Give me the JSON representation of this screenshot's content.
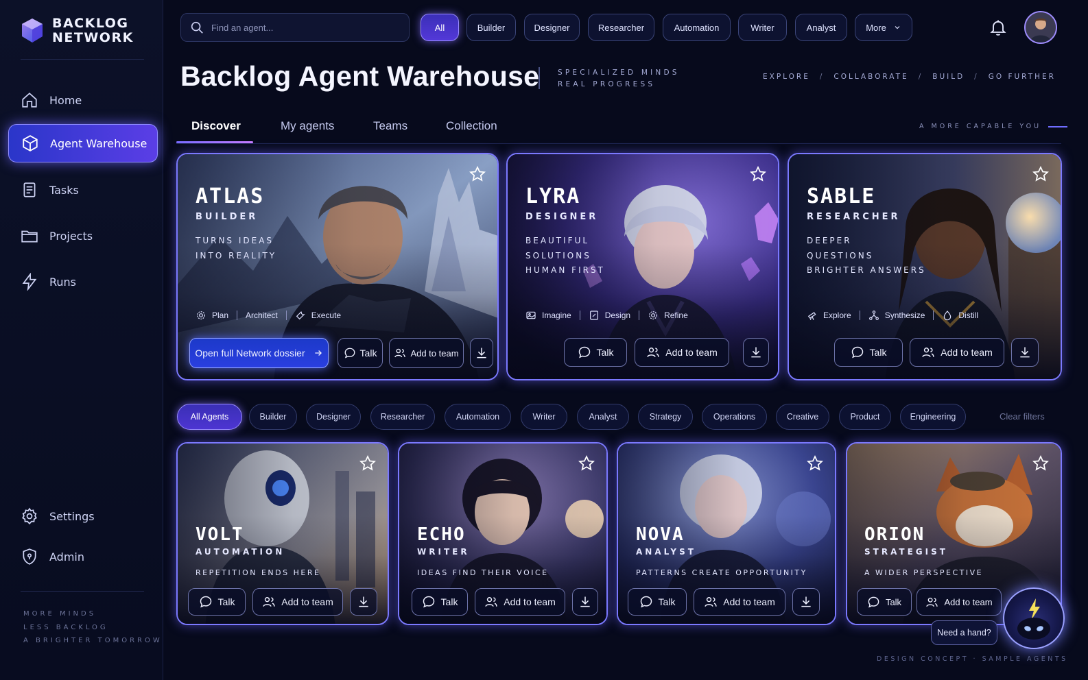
{
  "brand": {
    "line1": "BACKLOG",
    "line2": "NETWORK"
  },
  "sidebar": {
    "items": [
      {
        "label": "Home"
      },
      {
        "label": "Agent Warehouse"
      },
      {
        "label": "Tasks"
      },
      {
        "label": "Projects"
      },
      {
        "label": "Runs"
      }
    ],
    "bottom": [
      {
        "label": "Settings"
      },
      {
        "label": "Admin"
      }
    ],
    "tagline": [
      "MORE MINDS",
      "LESS BACKLOG",
      "A BRIGHTER TOMORROW"
    ]
  },
  "search": {
    "placeholder": "Find an agent..."
  },
  "top_filters": [
    "All",
    "Builder",
    "Designer",
    "Researcher",
    "Automation",
    "Writer",
    "Analyst",
    "More"
  ],
  "header": {
    "title": "Backlog Agent Warehouse",
    "sub1": "SPECIALIZED MINDS",
    "sub2": "REAL PROGRESS",
    "crumbs": [
      "EXPLORE",
      "COLLABORATE",
      "BUILD",
      "GO FURTHER"
    ]
  },
  "tabs": [
    "Discover",
    "My agents",
    "Teams",
    "Collection"
  ],
  "tab_tagline": "A MORE CAPABLE YOU",
  "featured": [
    {
      "name": "ATLAS",
      "role": "BUILDER",
      "tagline": [
        "TURNS IDEAS",
        "INTO REALITY"
      ],
      "skills": [
        "Plan",
        "Architect",
        "Execute"
      ],
      "primary": "Open full Network dossier"
    },
    {
      "name": "LYRA",
      "role": "DESIGNER",
      "tagline": [
        "BEAUTIFUL",
        "SOLUTIONS",
        "HUMAN FIRST"
      ],
      "skills": [
        "Imagine",
        "Design",
        "Refine"
      ]
    },
    {
      "name": "SABLE",
      "role": "RESEARCHER",
      "tagline": [
        "DEEPER",
        "QUESTIONS",
        "BRIGHTER ANSWERS"
      ],
      "skills": [
        "Explore",
        "Synthesize",
        "Distill"
      ]
    }
  ],
  "actions": {
    "talk": "Talk",
    "add": "Add to team"
  },
  "category_filters": [
    "All Agents",
    "Builder",
    "Designer",
    "Researcher",
    "Automation",
    "Writer",
    "Analyst",
    "Strategy",
    "Operations",
    "Creative",
    "Product",
    "Engineering"
  ],
  "clear_filters": "Clear filters",
  "agents": [
    {
      "name": "VOLT",
      "role": "AUTOMATION",
      "tagline": "REPETITION ENDS HERE"
    },
    {
      "name": "ECHO",
      "role": "WRITER",
      "tagline": "IDEAS FIND THEIR VOICE"
    },
    {
      "name": "NOVA",
      "role": "ANALYST",
      "tagline": "PATTERNS CREATE OPPORTUNITY"
    },
    {
      "name": "ORION",
      "role": "STRATEGIST",
      "tagline": "A WIDER PERSPECTIVE"
    }
  ],
  "help": {
    "label": "Need a hand?"
  },
  "footer": "DESIGN CONCEPT · SAMPLE AGENTS",
  "colors": {
    "accent": "#7b79ff",
    "primary_button": "#2a3fe0",
    "background": "#070a1c"
  }
}
